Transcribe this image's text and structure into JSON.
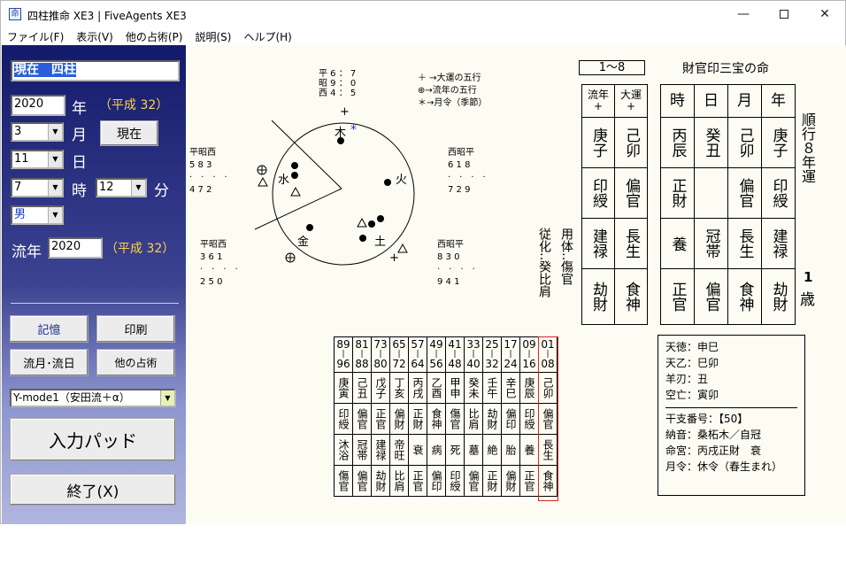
{
  "window": {
    "title": "四柱推命 XE3 | FiveAgents XE3",
    "icon": "app-icon",
    "controls": [
      "minimize",
      "maximize",
      "close"
    ]
  },
  "menu": [
    "ファイル(F)",
    "表示(V)",
    "他の占術(P)",
    "説明(S)",
    "ヘルプ(H)"
  ],
  "left": {
    "title_input": "現在　四柱",
    "year": "2020",
    "year_label": "年",
    "era": "（平成 32）",
    "month": "3",
    "month_label": "月",
    "now_button": "現在",
    "day": "11",
    "day_label": "日",
    "hour": "7",
    "hour_label": "時",
    "minute": "12",
    "minute_label": "分",
    "gender": "男",
    "ryunen_label": "流年",
    "ryunen_year": "2020",
    "ryunen_era": "（平成 32）",
    "buttons": {
      "memory": "記憶",
      "print": "印刷",
      "ryugetsu": "流月･流日",
      "other": "他の占術"
    },
    "mode_select": "Y-mode1（安田流＋α）",
    "pad_button": "入力パッド",
    "exit_button": "終了(X)"
  },
  "circle": {
    "legend": [
      "＋ →大運の五行",
      "⊕→流年の五行",
      "＊→月令（季節）"
    ],
    "elements": {
      "wood": "木",
      "fire": "火",
      "earth": "土",
      "metal": "金",
      "water": "水"
    },
    "top_block": [
      "平 6 ： 7",
      "昭 9 ： 0",
      "西 4 ： 5"
    ],
    "tl_block": {
      "label": "平昭西",
      "nums1": "5 8 3",
      "nums2": "4 7 2"
    },
    "tr_block": {
      "label": "西昭平",
      "nums1": "6 1 8",
      "nums2": "7 2 9"
    },
    "bl_block": {
      "label": "平昭西",
      "nums1": "3 6 1",
      "nums2": "2 5 0"
    },
    "br_block": {
      "label": "西昭平",
      "nums1": "8 3 0",
      "nums2": "9 4 1"
    },
    "marks": {
      "plus": "+",
      "oplus": "⊕",
      "star": "*",
      "tri": "△",
      "dot": "●"
    }
  },
  "range_label": "1～8",
  "main_title": "財官印三宝の命",
  "side_text": {
    "col1_top": "従化",
    "col1_mid": "‥",
    "col1_bot": "癸比肩",
    "col2": "用体‥傷官"
  },
  "luck_headers": {
    "ryunen": "流年",
    "ryunen_sign": "+",
    "taiun": "大運",
    "taiun_sign": "+"
  },
  "luck_stems": {
    "ryunen": "庚子",
    "taiun": "己卯"
  },
  "luck_stars1": {
    "ryunen": "印綬",
    "taiun": "偏官"
  },
  "luck_stars2": {
    "ryunen": "建禄",
    "taiun": "長生"
  },
  "luck_stars3": {
    "ryunen": "劫財",
    "taiun": "食神"
  },
  "pillar_headers": [
    "時",
    "日",
    "月",
    "年"
  ],
  "pillar_stems": [
    "丙辰",
    "癸丑",
    "己卯",
    "庚子"
  ],
  "pillar_stars1": [
    "正財",
    "",
    "偏官",
    "印綬"
  ],
  "pillar_stars2": [
    "養",
    "冠帯",
    "長生",
    "建禄"
  ],
  "pillar_stars3": [
    "正官",
    "偏官",
    "食神",
    "劫財"
  ],
  "direction_text": "順行８年運",
  "age_num": "1",
  "age_unit": "歳",
  "table_cols": [
    {
      "from": "89",
      "to": "96",
      "stem": "庚寅",
      "star1": "印綬",
      "stage": "沐浴",
      "star2": "傷官"
    },
    {
      "from": "81",
      "to": "88",
      "stem": "己丑",
      "star1": "偏官",
      "stage": "冠帯",
      "star2": "偏官"
    },
    {
      "from": "73",
      "to": "80",
      "stem": "戊子",
      "star1": "正官",
      "stage": "建禄",
      "star2": "劫財"
    },
    {
      "from": "65",
      "to": "72",
      "stem": "丁亥",
      "star1": "偏財",
      "stage": "帝旺",
      "star2": "比肩"
    },
    {
      "from": "57",
      "to": "64",
      "stem": "丙戌",
      "star1": "正財",
      "stage": "衰",
      "star2": "正官"
    },
    {
      "from": "49",
      "to": "56",
      "stem": "乙酉",
      "star1": "食神",
      "stage": "病",
      "star2": "偏印"
    },
    {
      "from": "41",
      "to": "48",
      "stem": "甲申",
      "star1": "傷官",
      "stage": "死",
      "star2": "印綬"
    },
    {
      "from": "33",
      "to": "40",
      "stem": "癸未",
      "star1": "比肩",
      "stage": "墓",
      "star2": "偏官"
    },
    {
      "from": "25",
      "to": "32",
      "stem": "壬午",
      "star1": "劫財",
      "stage": "絶",
      "star2": "正財"
    },
    {
      "from": "17",
      "to": "24",
      "stem": "辛巳",
      "star1": "偏印",
      "stage": "胎",
      "star2": "偏財"
    },
    {
      "from": "09",
      "to": "16",
      "stem": "庚辰",
      "star1": "印綬",
      "stage": "養",
      "star2": "正官"
    },
    {
      "from": "01",
      "to": "08",
      "stem": "己卯",
      "star1": "偏官",
      "stage": "長生",
      "star2": "食神"
    }
  ],
  "info": {
    "tentoku": "天徳：申巳",
    "tenotsu": "天乙：巳卯",
    "youjin": "羊刃：丑",
    "kubou": "空亡：寅卯",
    "kanshi": "干支番号：【50】",
    "nouon": "納音：桑柘木／自冠",
    "meikyu": "命宮：丙戌正財　衰",
    "getsurei": "月令：休令（春生まれ）"
  }
}
